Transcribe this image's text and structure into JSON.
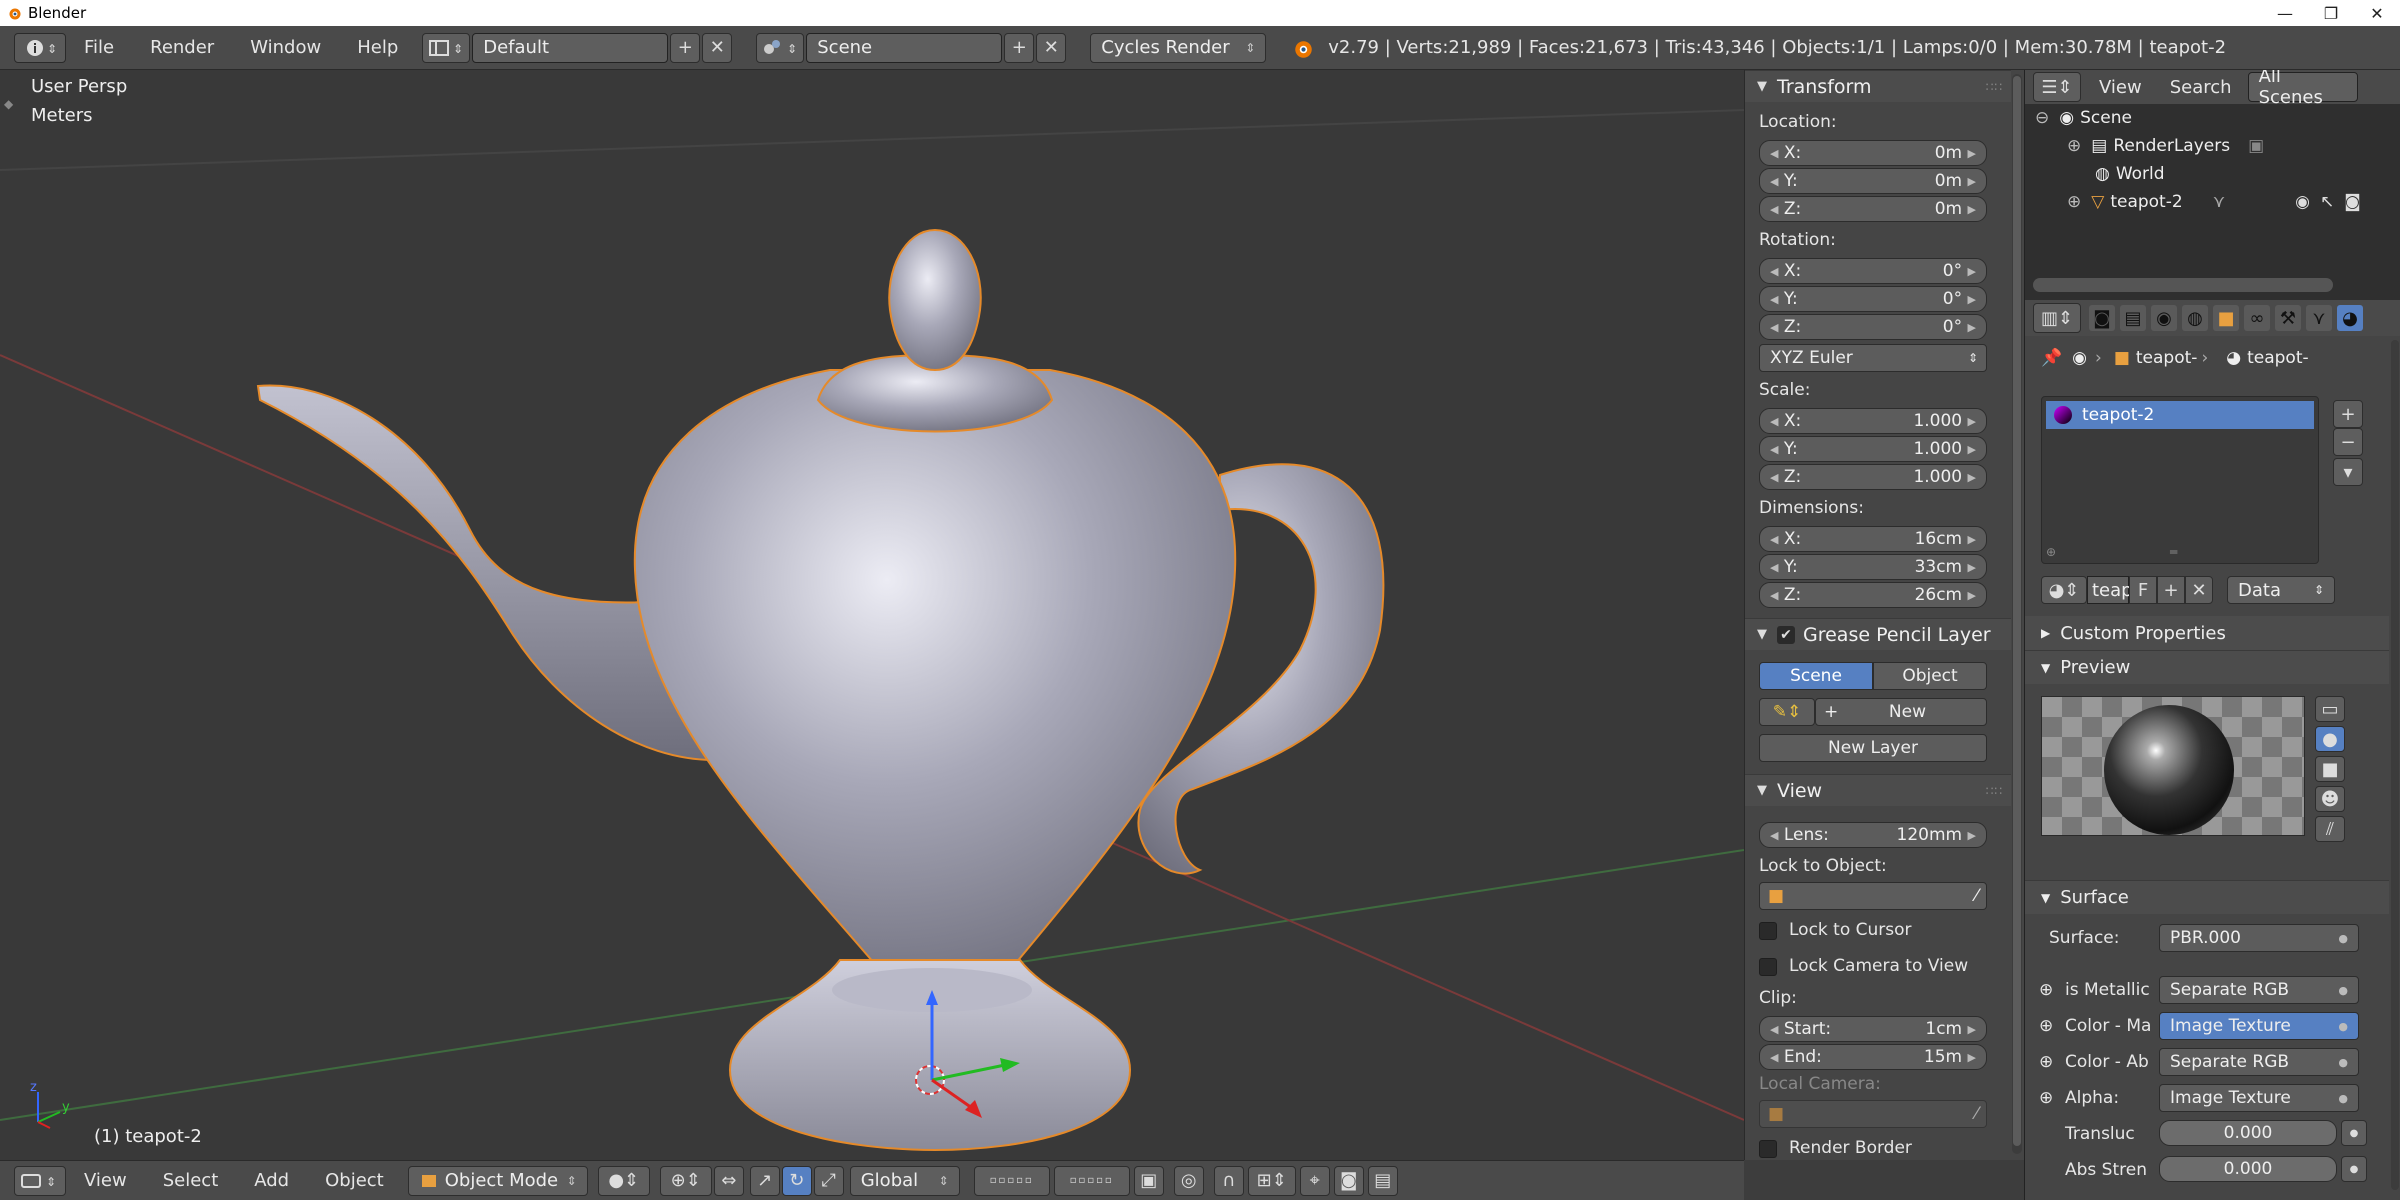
{
  "window": {
    "title": "Blender",
    "controls": [
      "—",
      "❐",
      "✕"
    ]
  },
  "info_header": {
    "menus": [
      "File",
      "Render",
      "Window",
      "Help"
    ],
    "layout": "Default",
    "scene": "Scene",
    "engine": "Cycles Render",
    "stats": "v2.79 | Verts:21,989 | Faces:21,673 | Tris:43,346 | Objects:1/1 | Lamps:0/0 | Mem:30.78M | teapot-2"
  },
  "viewport": {
    "view_name": "User Persp",
    "units": "Meters",
    "object_label": "(1) teapot-2",
    "axis_z": "z",
    "axis_y": "y"
  },
  "bottom_header": {
    "menus": [
      "View",
      "Select",
      "Add",
      "Object"
    ],
    "mode": "Object Mode",
    "orientation": "Global"
  },
  "npanel": {
    "transform": {
      "title": "Transform",
      "location_label": "Location:",
      "location": [
        {
          "axis": "X:",
          "value": "0m"
        },
        {
          "axis": "Y:",
          "value": "0m"
        },
        {
          "axis": "Z:",
          "value": "0m"
        }
      ],
      "rotation_label": "Rotation:",
      "rotation": [
        {
          "axis": "X:",
          "value": "0°"
        },
        {
          "axis": "Y:",
          "value": "0°"
        },
        {
          "axis": "Z:",
          "value": "0°"
        }
      ],
      "rotation_mode": "XYZ Euler",
      "scale_label": "Scale:",
      "scale": [
        {
          "axis": "X:",
          "value": "1.000"
        },
        {
          "axis": "Y:",
          "value": "1.000"
        },
        {
          "axis": "Z:",
          "value": "1.000"
        }
      ],
      "dimensions_label": "Dimensions:",
      "dimensions": [
        {
          "axis": "X:",
          "value": "16cm"
        },
        {
          "axis": "Y:",
          "value": "33cm"
        },
        {
          "axis": "Z:",
          "value": "26cm"
        }
      ]
    },
    "grease_pencil": {
      "title": "Grease Pencil Layer",
      "scene_btn": "Scene",
      "object_btn": "Object",
      "new_btn": "New",
      "new_layer_btn": "New Layer"
    },
    "view": {
      "title": "View",
      "lens_label": "Lens:",
      "lens_value": "120mm",
      "lock_to_object": "Lock to Object:",
      "lock_to_cursor": "Lock to Cursor",
      "lock_camera": "Lock Camera to View",
      "clip_label": "Clip:",
      "clip_start_label": "Start:",
      "clip_start": "1cm",
      "clip_end_label": "End:",
      "clip_end": "15m",
      "local_camera": "Local Camera:",
      "render_border": "Render Border"
    }
  },
  "outliner": {
    "menus": [
      "View",
      "Search"
    ],
    "filter": "All Scenes",
    "rows": [
      "Scene",
      "RenderLayers",
      "World",
      "teapot-2"
    ]
  },
  "properties": {
    "breadcrumb": [
      "teapot-",
      "teapot-"
    ],
    "material_slot": "teapot-2",
    "material_name": "teapo",
    "fake_user": "F",
    "link": "Data",
    "custom_properties": "Custom Properties",
    "preview": "Preview",
    "surface_panel": "Surface",
    "surface_label": "Surface:",
    "surface_value": "PBR.000",
    "inputs": [
      {
        "label": "is Metallic",
        "value": "Separate RGB",
        "active": false
      },
      {
        "label": "Color - Ma",
        "value": "Image Texture",
        "active": true
      },
      {
        "label": "Color - Ab",
        "value": "Separate RGB",
        "active": false
      },
      {
        "label": "Alpha:",
        "value": "Image Texture",
        "active": false
      }
    ],
    "sliders": [
      {
        "label": "Transluc",
        "value": "0.000"
      },
      {
        "label": "Abs Stren",
        "value": "0.000"
      }
    ]
  },
  "colors": {
    "accent": "#5680c2",
    "object_outline": "#e58a2a",
    "viewport_bg": "#393939"
  }
}
